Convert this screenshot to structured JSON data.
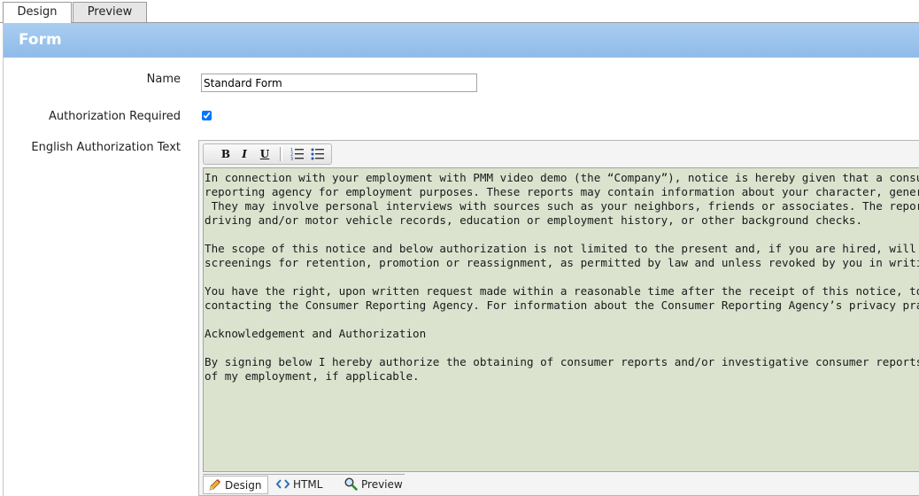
{
  "tabs": [
    {
      "label": "Design"
    },
    {
      "label": "Preview"
    }
  ],
  "panel": {
    "title": "Form"
  },
  "fields": {
    "name_label": "Name",
    "name_value": "Standard Form",
    "auth_required_label": "Authorization Required",
    "auth_required_checked": true,
    "auth_text_label": "English Authorization Text"
  },
  "toolbar": {
    "bold": "B",
    "italic": "I",
    "underline": "U"
  },
  "editor": {
    "paragraphs": [
      [
        "In connection with your employment with PMM video demo (the “Company”), notice is hereby given that a consumer report",
        "reporting agency for employment purposes. These reports may contain information about your character, general reputation",
        " They may involve personal interviews with sources such as your neighbors, friends or associates. The reports may also cor",
        "driving and/or motor vehicle records, education or employment history, or other background checks."
      ],
      [
        "The scope of this notice and below authorization is not limited to the present and, if you are hired, will continue throughout",
        "screenings for retention, promotion or reassignment, as permitted by law and unless revoked by you in writing."
      ],
      [
        "You have the right, upon written request made within a reasonable time after the receipt of this notice, to request disclosur",
        "contacting the Consumer Reporting Agency. For information about the Consumer Reporting Agency’s privacy practices, plea"
      ],
      [
        "Acknowledgement and Authorization"
      ],
      [
        "By signing below I hereby authorize the obtaining of consumer reports and/or investigative consumer reports by the Compa",
        "of my employment, if applicable."
      ]
    ],
    "modes": [
      {
        "label": "Design",
        "icon": "pencil-icon"
      },
      {
        "label": "HTML",
        "icon": "code-icon"
      },
      {
        "label": "Preview",
        "icon": "magnifier-icon"
      }
    ]
  }
}
